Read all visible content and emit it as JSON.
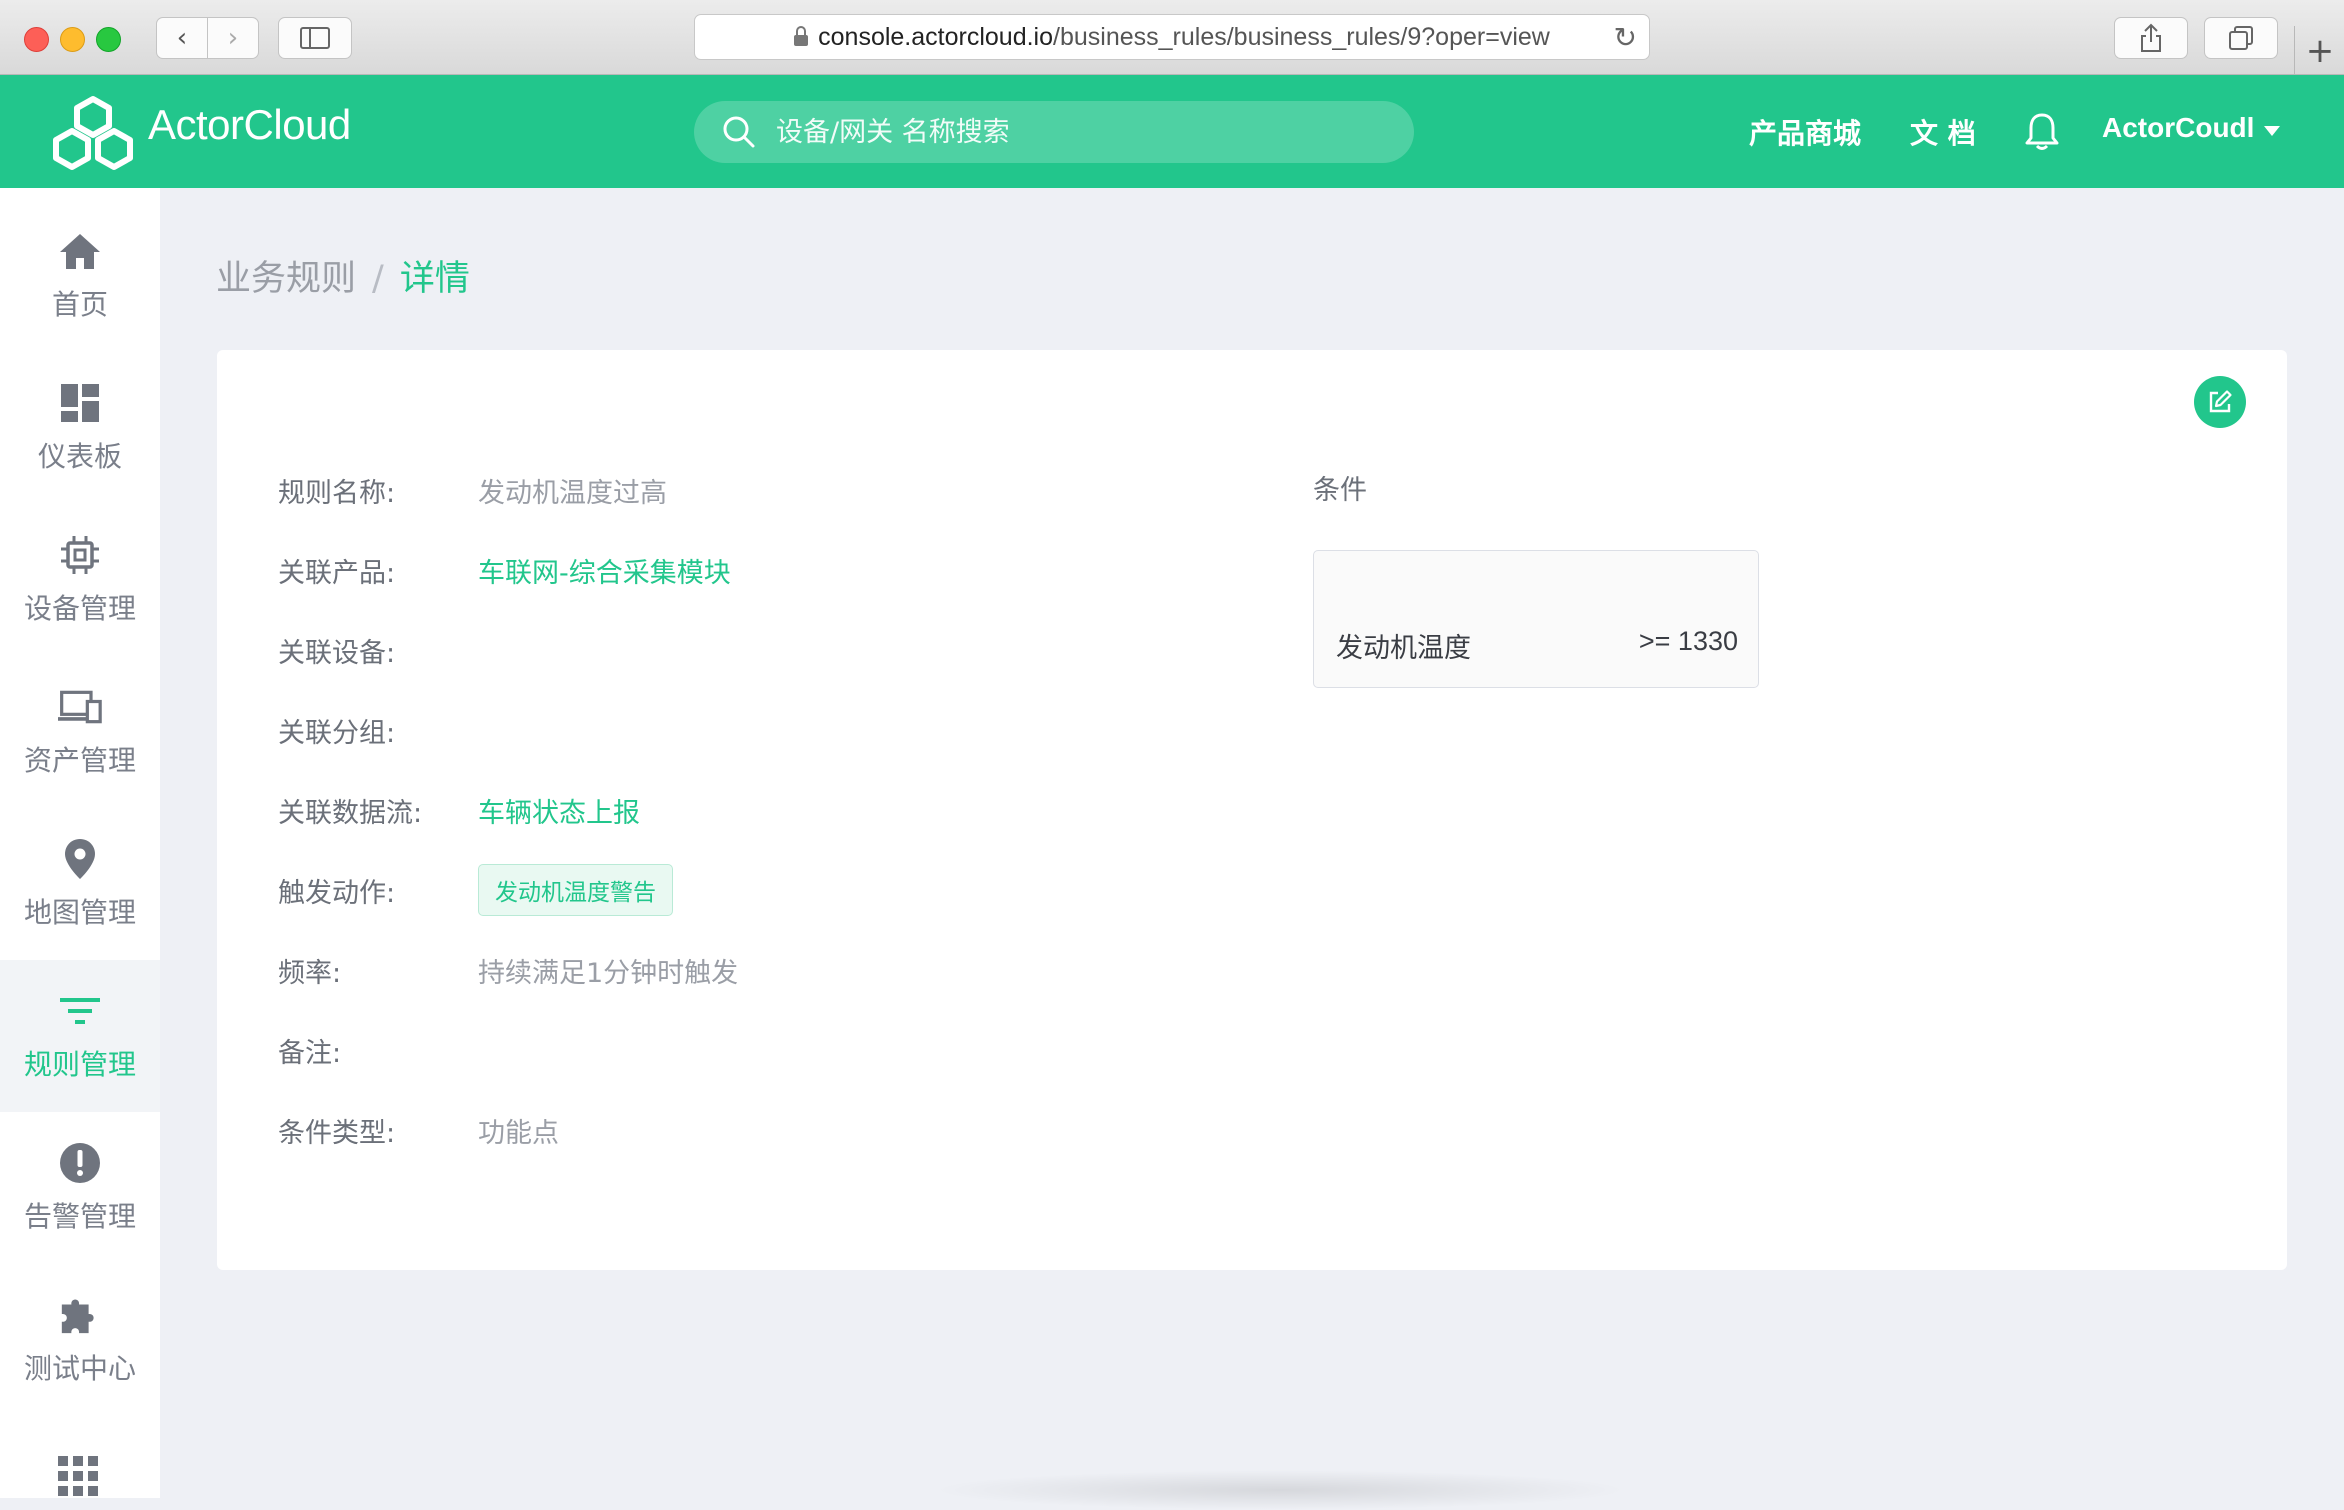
{
  "browser": {
    "url_host": "console.actorcloud.io",
    "url_path": "/business_rules/business_rules/9?oper=view"
  },
  "header": {
    "brand": "ActorCloud",
    "search_placeholder": "设备/网关 名称搜索",
    "links": [
      "产品商城",
      "文 档"
    ],
    "username": "ActorCoudl",
    "accent_color": "#22c68c"
  },
  "sidebar": {
    "items": [
      {
        "label": "首页",
        "icon": "home-icon"
      },
      {
        "label": "仪表板",
        "icon": "dashboard-icon"
      },
      {
        "label": "设备管理",
        "icon": "chip-icon"
      },
      {
        "label": "资产管理",
        "icon": "devices-icon"
      },
      {
        "label": "地图管理",
        "icon": "map-pin-icon"
      },
      {
        "label": "规则管理",
        "icon": "filter-icon",
        "active": true
      },
      {
        "label": "告警管理",
        "icon": "alert-icon"
      },
      {
        "label": "测试中心",
        "icon": "puzzle-icon"
      }
    ]
  },
  "breadcrumb": {
    "parent": "业务规则",
    "separator": "/",
    "current": "详情"
  },
  "detail": {
    "fields": [
      {
        "label": "规则名称:",
        "value": "发动机温度过高"
      },
      {
        "label": "关联产品:",
        "value": "车联网-综合采集模块"
      },
      {
        "label": "关联设备:",
        "value": ""
      },
      {
        "label": "关联分组:",
        "value": ""
      },
      {
        "label": "关联数据流:",
        "value": "车辆状态上报"
      },
      {
        "label": "触发动作:",
        "value": "发动机温度警告"
      },
      {
        "label": "频率:",
        "value": "持续满足1分钟时触发"
      },
      {
        "label": "备注:",
        "value": ""
      },
      {
        "label": "条件类型:",
        "value": "功能点"
      }
    ],
    "condition": {
      "title": "条件",
      "name": "发动机温度",
      "expression": ">= 1330"
    }
  }
}
